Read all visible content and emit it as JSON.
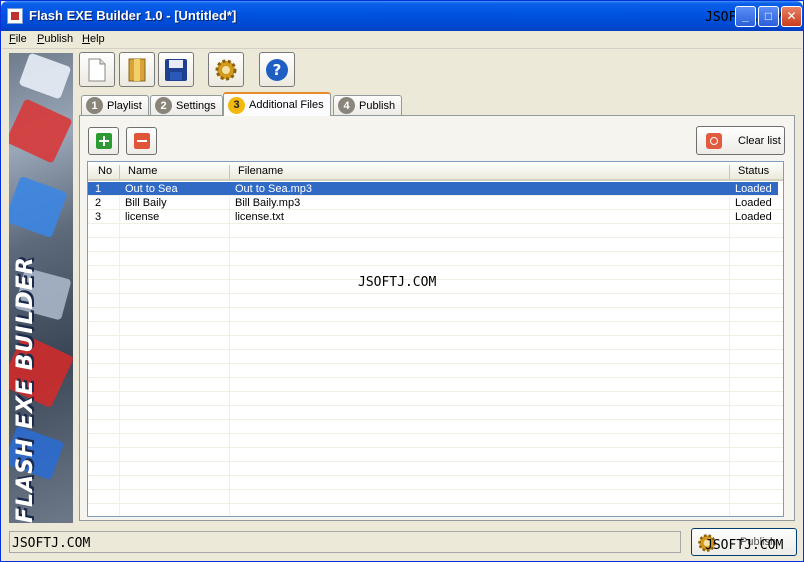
{
  "window": {
    "title": "Flash EXE Builder 1.0 - [Untitled*]",
    "watermark": "JSOFTJ.COM"
  },
  "titlebar_buttons": {
    "minimize": "_",
    "maximize": "□",
    "close": "✕"
  },
  "menu": [
    {
      "label": "File",
      "accel": "F",
      "rest": "ile"
    },
    {
      "label": "Publish",
      "accel": "P",
      "rest": "ublish"
    },
    {
      "label": "Help",
      "accel": "H",
      "rest": "elp"
    }
  ],
  "banner": {
    "text": "FLASH EXE BUILDER"
  },
  "toolbar": [
    {
      "icon": "new-document-icon"
    },
    {
      "icon": "open-folder-icon"
    },
    {
      "icon": "save-disk-icon"
    },
    {
      "icon": "gear-icon"
    },
    {
      "icon": "help-icon"
    }
  ],
  "tabs": [
    {
      "num": "1",
      "label": "Playlist"
    },
    {
      "num": "2",
      "label": "Settings"
    },
    {
      "num": "3",
      "label": "Additional Files",
      "active": true
    },
    {
      "num": "4",
      "label": "Publish"
    }
  ],
  "actions": {
    "clear_label": "Clear list"
  },
  "list": {
    "columns": [
      "No",
      "Name",
      "Filename",
      "Status"
    ],
    "rows": [
      {
        "no": "1",
        "name": "Out to Sea",
        "filename": "Out to Sea.mp3",
        "status": "Loaded",
        "selected": true
      },
      {
        "no": "2",
        "name": "Bill Baily",
        "filename": "Bill Baily.mp3",
        "status": "Loaded"
      },
      {
        "no": "3",
        "name": "license",
        "filename": "license.txt",
        "status": "Loaded"
      }
    ]
  },
  "watermark_center": "JSOFTJ.COM",
  "status_text": "JSOFTJ.COM",
  "publish_button": {
    "label": "Publish",
    "watermark": "JSOFTJ.COM"
  },
  "colors": {
    "title_bar": "#0054e3",
    "selection": "#316ac5",
    "active_tab_accent": "#f2b90c"
  }
}
